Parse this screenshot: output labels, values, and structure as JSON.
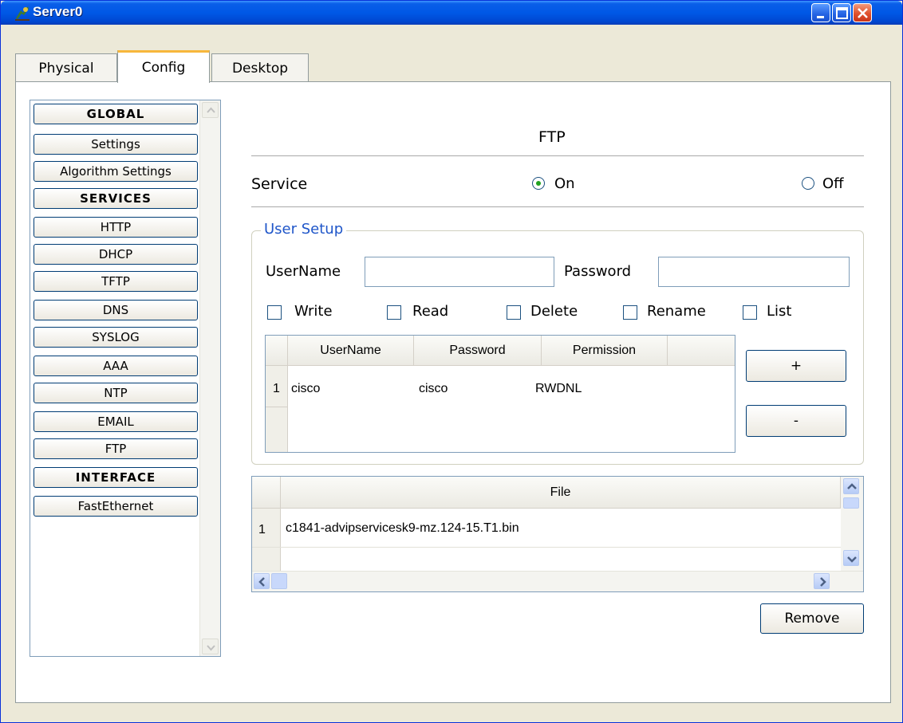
{
  "window": {
    "title": "Server0"
  },
  "tabs": [
    {
      "label": "Physical"
    },
    {
      "label": "Config"
    },
    {
      "label": "Desktop"
    }
  ],
  "sidebar": {
    "items": [
      {
        "label": "GLOBAL",
        "header": true
      },
      {
        "label": "Settings"
      },
      {
        "label": "Algorithm Settings"
      },
      {
        "label": "SERVICES",
        "header": true
      },
      {
        "label": "HTTP"
      },
      {
        "label": "DHCP"
      },
      {
        "label": "TFTP"
      },
      {
        "label": "DNS"
      },
      {
        "label": "SYSLOG"
      },
      {
        "label": "AAA"
      },
      {
        "label": "NTP"
      },
      {
        "label": "EMAIL"
      },
      {
        "label": "FTP"
      },
      {
        "label": "INTERFACE",
        "header": true
      },
      {
        "label": "FastEthernet"
      }
    ]
  },
  "main": {
    "title": "FTP",
    "service_label": "Service",
    "on_label": "On",
    "off_label": "Off",
    "service_state": "On",
    "user_setup": {
      "legend": "User Setup",
      "username_label": "UserName",
      "username_value": "",
      "password_label": "Password",
      "password_value": "",
      "permissions": [
        {
          "label": "Write",
          "checked": false
        },
        {
          "label": "Read",
          "checked": false
        },
        {
          "label": "Delete",
          "checked": false
        },
        {
          "label": "Rename",
          "checked": false
        },
        {
          "label": "List",
          "checked": false
        }
      ],
      "table": {
        "columns": [
          "UserName",
          "Password",
          "Permission"
        ],
        "rows": [
          {
            "index": "1",
            "username": "cisco",
            "password": "cisco",
            "permission": "RWDNL"
          }
        ]
      },
      "add_label": "+",
      "remove_label": "-"
    },
    "files": {
      "column": "File",
      "rows": [
        {
          "index": "1",
          "name": "c1841-advipservicesk9-mz.124-15.T1.bin"
        }
      ]
    },
    "remove_button_label": "Remove"
  },
  "colors": {
    "titlebar": "#0058e6",
    "legend_text": "#1f56c9",
    "radio_dot": "#21a121",
    "tab_highlight": "#f7b73c"
  }
}
